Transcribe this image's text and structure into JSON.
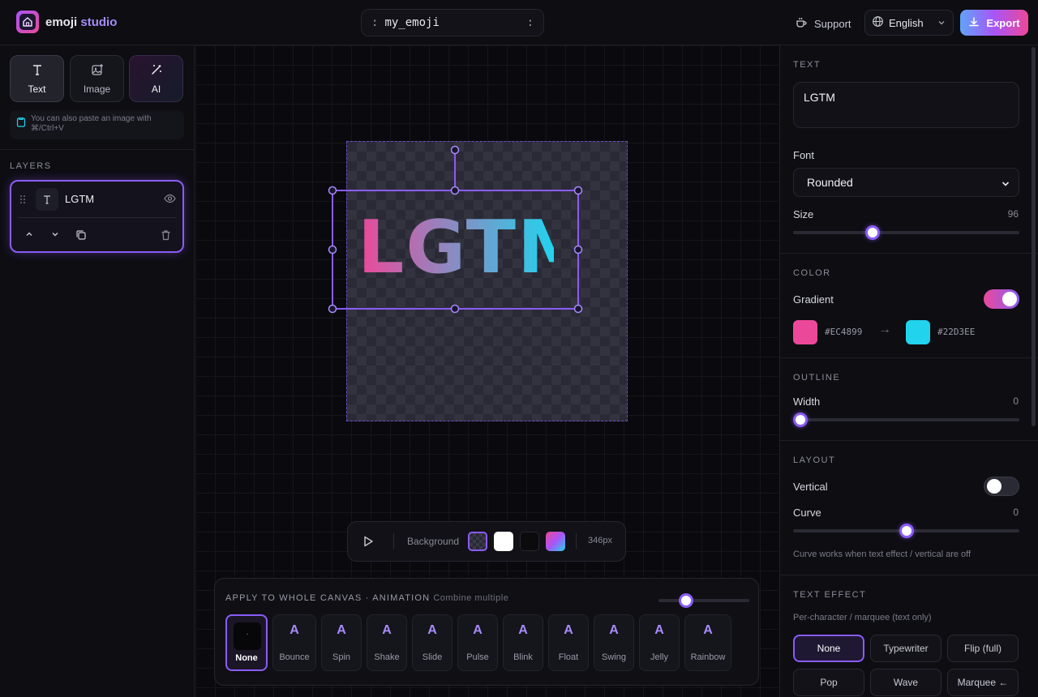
{
  "header": {
    "brand_main": "emoji ",
    "brand_accent": "studio",
    "filename": "my_emoji",
    "colon": ":",
    "support": "Support",
    "language": "English",
    "export": "Export"
  },
  "tools": [
    {
      "label": "Text",
      "icon": "text-icon"
    },
    {
      "label": "Image",
      "icon": "image-add-icon"
    },
    {
      "label": "AI",
      "icon": "magic-wand-icon"
    }
  ],
  "hint": "You can also paste an image with ⌘/Ctrl+V",
  "layers": {
    "title": "LAYERS",
    "items": [
      {
        "name": "LGTM",
        "type": "text"
      }
    ]
  },
  "canvas": {
    "text": "LGTM",
    "gradient_from": "#EC4899",
    "gradient_to": "#22D3EE"
  },
  "playbar": {
    "background_label": "Background",
    "size": "346px",
    "background_options": [
      "transparent",
      "white",
      "black",
      "gradient"
    ]
  },
  "animation": {
    "title": "APPLY TO WHOLE CANVAS · ANIMATION",
    "subtitle": "Combine multiple",
    "speed_fraction": 0.3,
    "options": [
      {
        "label": "None",
        "glyph": "·",
        "selected": true
      },
      {
        "label": "Bounce",
        "glyph": "A"
      },
      {
        "label": "Spin",
        "glyph": "A"
      },
      {
        "label": "Shake",
        "glyph": "A"
      },
      {
        "label": "Slide",
        "glyph": "A"
      },
      {
        "label": "Pulse",
        "glyph": "A"
      },
      {
        "label": "Blink",
        "glyph": "A"
      },
      {
        "label": "Float",
        "glyph": "A"
      },
      {
        "label": "Swing",
        "glyph": "A"
      },
      {
        "label": "Jelly",
        "glyph": "A"
      },
      {
        "label": "Rainbow",
        "glyph": "A"
      }
    ]
  },
  "panel": {
    "text_section": "TEXT",
    "text_value": "LGTM",
    "font_label": "Font",
    "font_value": "Rounded",
    "size_label": "Size",
    "size_value": "96",
    "size_fraction": 0.34,
    "color_section": "COLOR",
    "gradient_label": "Gradient",
    "gradient_on": true,
    "color_from": "#EC4899",
    "color_to": "#22D3EE",
    "arrow": "→",
    "outline_section": "OUTLINE",
    "width_label": "Width",
    "width_value": "0",
    "width_fraction": 0,
    "layout_section": "LAYOUT",
    "vertical_label": "Vertical",
    "vertical_on": false,
    "curve_label": "Curve",
    "curve_value": "0",
    "curve_fraction": 0.5,
    "curve_note": "Curve works when text effect / vertical are off",
    "effect_section": "TEXT EFFECT",
    "effect_note": "Per-character / marquee (text only)",
    "effects": [
      "None",
      "Typewriter",
      "Flip (full)",
      "Pop",
      "Wave",
      "Marquee ←"
    ],
    "effect_selected": "None"
  },
  "colors": {
    "accent": "#8B5CF6",
    "bg": "#0B0B10"
  }
}
